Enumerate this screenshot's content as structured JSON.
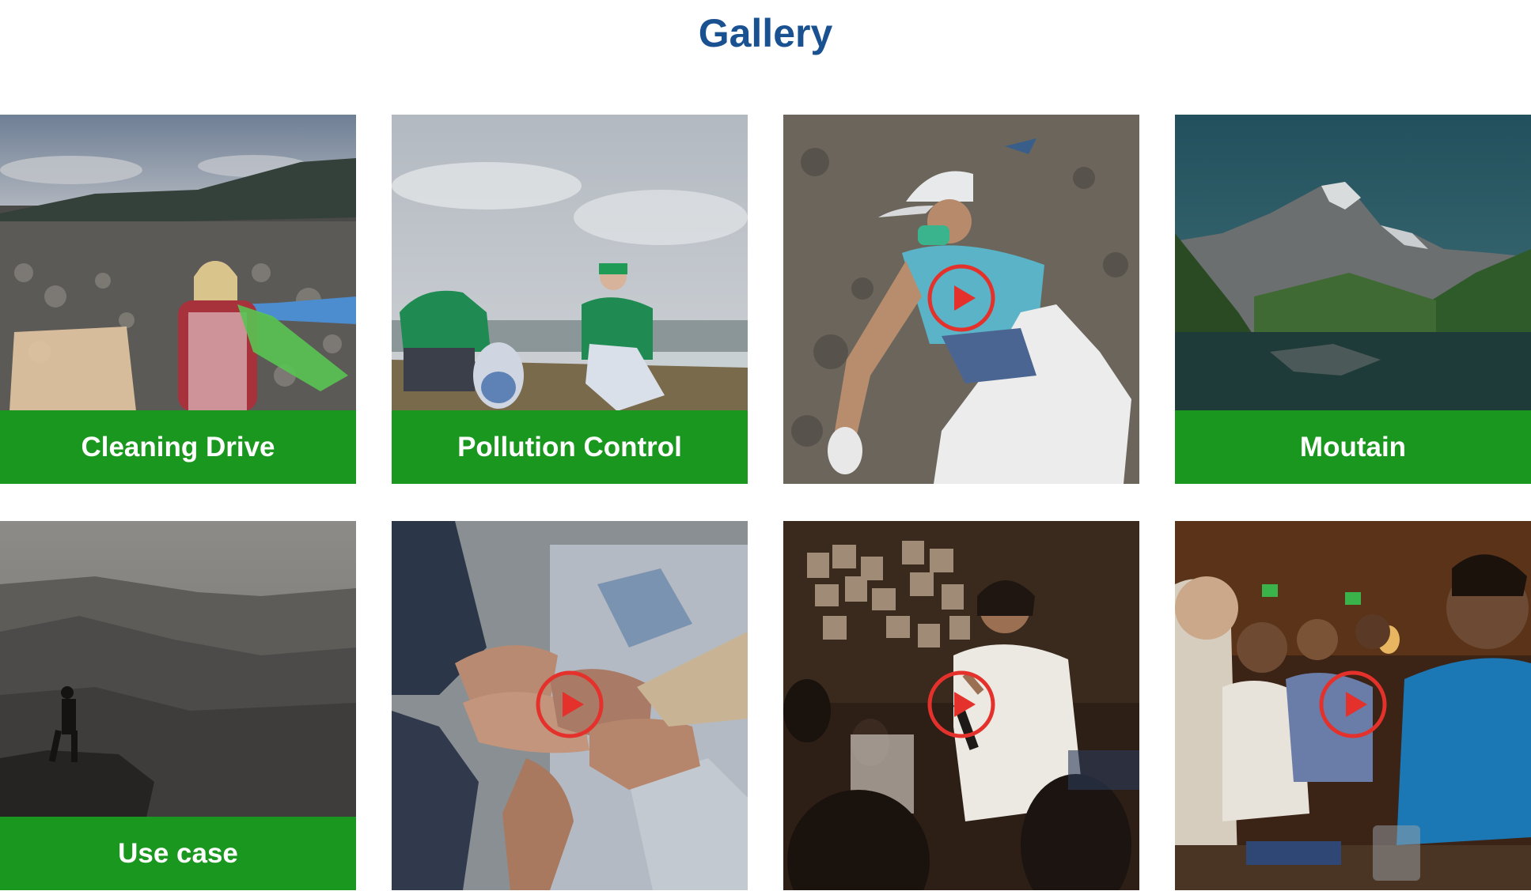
{
  "page": {
    "title": "Gallery"
  },
  "colors": {
    "title": "#1a5190",
    "caption_bg": "#1a971e",
    "play_icon": "#e5312b"
  },
  "gallery": {
    "items": [
      {
        "caption": "Cleaning Drive",
        "media": "photo",
        "scene": "woman-collecting-trash-landfill"
      },
      {
        "caption": "Pollution Control",
        "media": "photo",
        "scene": "volunteers-picking-litter-riverbank"
      },
      {
        "caption": "",
        "media": "video",
        "scene": "volunteer-cleaning-beach"
      },
      {
        "caption": "Moutain",
        "media": "photo",
        "scene": "mountain-lake"
      },
      {
        "caption": "Use case",
        "media": "photo",
        "scene": "hiker-on-cliff"
      },
      {
        "caption": "",
        "media": "video",
        "scene": "linked-hands-teamwork"
      },
      {
        "caption": "",
        "media": "video",
        "scene": "woman-speaking-at-conference"
      },
      {
        "caption": "",
        "media": "video",
        "scene": "audience-at-seminar"
      }
    ]
  }
}
